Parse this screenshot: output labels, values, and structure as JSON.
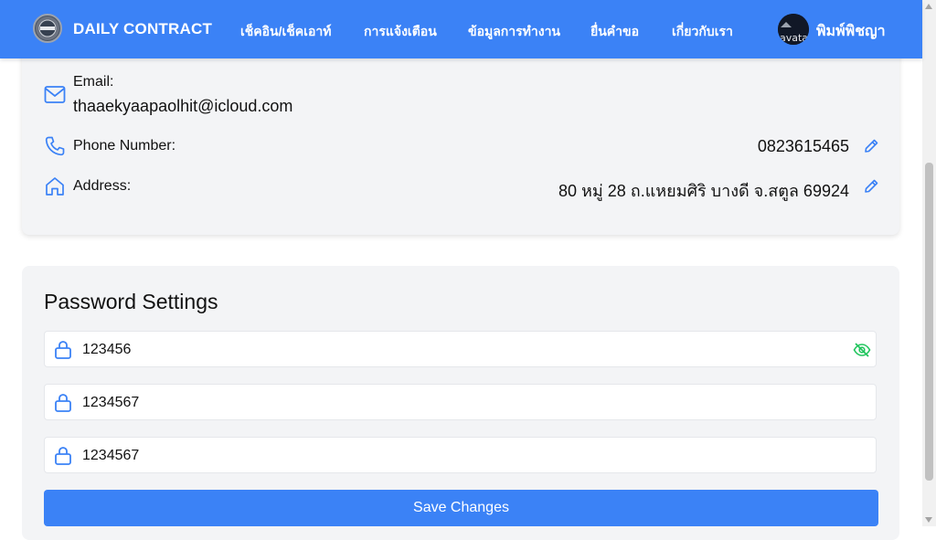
{
  "navbar": {
    "brand": "DAILY CONTRACT",
    "links": [
      "เช็คอิน/เช็คเอาท์",
      "การแจ้งเตือน",
      "ข้อมูลการทำงาน",
      "ยื่นคำขอ",
      "เกี่ยวกับเรา"
    ],
    "user_name": "พิมพ์พิชญา",
    "avatar_alt": "avatar"
  },
  "contact": {
    "email_label": "Email:",
    "email_value": "thaaekyaapaolhit@icloud.com",
    "phone_label": "Phone Number:",
    "phone_value": "0823615465",
    "address_label": "Address:",
    "address_value": "80 หมู่ 28 ถ.แหยมศิริ บางดี จ.สตูล 69924"
  },
  "password_settings": {
    "title": "Password Settings",
    "fields": [
      "123456",
      "1234567",
      "1234567"
    ],
    "save_label": "Save Changes"
  },
  "colors": {
    "primary": "#3b82f6",
    "card_bg": "#f3f4f6",
    "eye_icon": "#22c55e"
  },
  "icons": [
    "mail-icon",
    "phone-icon",
    "home-icon",
    "pencil-icon",
    "lock-icon",
    "eye-off-icon"
  ]
}
